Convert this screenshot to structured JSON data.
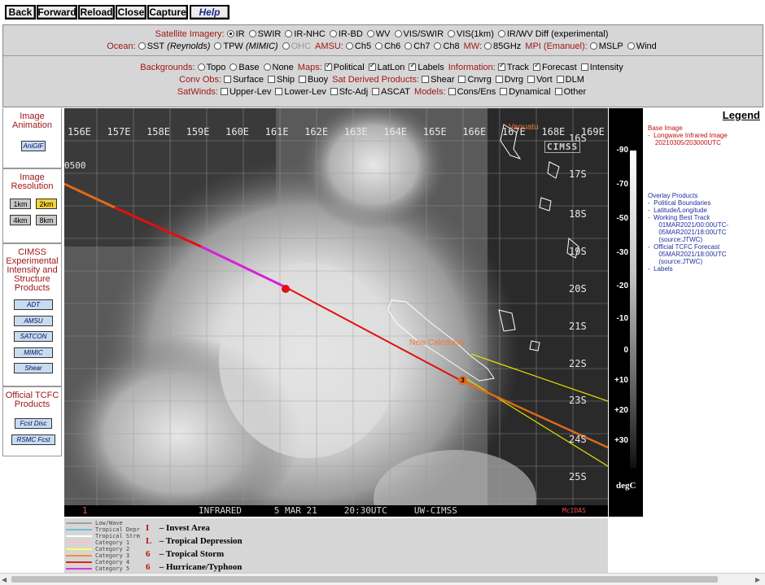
{
  "nav": {
    "back": "Back",
    "forward": "Forward",
    "reload": "Reload",
    "close": "Close",
    "capture": "Capture",
    "help": "Help"
  },
  "controls": {
    "satellite_label": "Satellite Imagery:",
    "sat_options": [
      "IR",
      "SWIR",
      "IR-NHC",
      "IR-BD",
      "WV",
      "VIS/SWIR",
      "VIS(1km)",
      "IR/WV Diff (experimental)"
    ],
    "ocean_label": "Ocean:",
    "sst": "SST",
    "sst_sub": "(Reynolds)",
    "tpw": "TPW",
    "tpw_sub": "(MIMIC)",
    "ohc": "OHC",
    "amsu_label": "AMSU:",
    "amsu_options": [
      "Ch5",
      "Ch6",
      "Ch7",
      "Ch8"
    ],
    "mw_label": "MW:",
    "mw_options": [
      "85GHz"
    ],
    "mpi_label": "MPI (Emanuel):",
    "mpi_options": [
      "MSLP",
      "Wind"
    ],
    "backgrounds_label": "Backgrounds:",
    "bg_options": [
      "Topo",
      "Base",
      "None"
    ],
    "maps_label": "Maps:",
    "maps_options": [
      "Political",
      "LatLon",
      "Labels"
    ],
    "info_label": "Information:",
    "info_options": [
      "Track",
      "Forecast",
      "Intensity"
    ],
    "conv_label": "Conv Obs:",
    "conv_options": [
      "Surface",
      "Ship",
      "Buoy"
    ],
    "satderived_label": "Sat Derived Products:",
    "satderived_options": [
      "Shear",
      "Cnvrg",
      "Dvrg",
      "Vort",
      "DLM"
    ],
    "satwinds_label": "SatWinds:",
    "satwinds_options": [
      "Upper-Lev",
      "Lower-Lev",
      "Sfc-Adj",
      "ASCAT"
    ],
    "models_label": "Models:",
    "models_options": [
      "Cons/Ens",
      "Dynamical",
      "Other"
    ]
  },
  "sidebar": {
    "animation_title": "Image Animation",
    "anigif": "AniGIF",
    "resolution_title": "Image Resolution",
    "res": [
      "1km",
      "2km",
      "4km",
      "8km"
    ],
    "cimss_title": "CIMSS Experimental Intensity and Structure Products",
    "cimss_buttons": [
      "ADT",
      "AMSU",
      "SATCON",
      "MIMIC",
      "Shear"
    ],
    "official_title": "Official TCFC Products",
    "official_buttons": [
      "Fcst Disc",
      "RSMC Fcst"
    ]
  },
  "map": {
    "lon_labels": [
      "156E",
      "157E",
      "158E",
      "159E",
      "160E",
      "161E",
      "162E",
      "163E",
      "164E",
      "165E",
      "166E",
      "167E",
      "168E",
      "169E"
    ],
    "lat_labels": [
      "16S",
      "17S",
      "18S",
      "19S",
      "20S",
      "21S",
      "22S",
      "23S",
      "24S",
      "25S"
    ],
    "time_label": "0500",
    "place_label": "New Caledonia",
    "top_place": "Vanuatu",
    "cimss_tag": "CIMSS",
    "footer_num": "1",
    "footer_text": "INFRARED      5 MAR 21     20:30UTC     UW-CIMSS",
    "mcidas": "McIDAS",
    "forecast_marker": "3",
    "colors": {
      "track_orange": "#e06a18",
      "track_red": "#e01010",
      "track_magenta": "#d820d8",
      "cone": "#e0e000"
    }
  },
  "colorbar": {
    "ticks": [
      "-90",
      "-70",
      "-50",
      "-30",
      "-20",
      "-10",
      "0",
      "+10",
      "+20",
      "+30"
    ],
    "unit": "degC"
  },
  "legend": {
    "title": "Legend",
    "base_header": "Base Image",
    "base_items": [
      "-  Longwave Infrared Image",
      "    20210305/203000UTC"
    ],
    "overlay_header": "Overlay Products",
    "overlay_items": [
      "-  Political Boundaries",
      "-  Latitude/Longitude",
      "-  Working Best Track",
      "      01MAR2021/00:00UTC-",
      "      05MAR2021/18:00UTC",
      "      (source:JTWC)",
      "-  Official TCFC Forecast",
      "      05MAR2021/18:00UTC",
      "      (source:JTWC)",
      "-  Labels"
    ]
  },
  "key": {
    "categories": [
      "Low/Wave",
      "Tropical Depr",
      "Tropical Strm",
      "Category 1",
      "Category 2",
      "Category 3",
      "Category 4",
      "Category 5"
    ],
    "category_colors": [
      "#a0a0a0",
      "#70c0d0",
      "#ffffff",
      "#ffc0c8",
      "#ffff60",
      "#f09030",
      "#e02020",
      "#e030e0"
    ],
    "symbols": [
      "– Invest Area",
      "– Tropical Depression",
      "– Tropical Storm",
      "– Hurricane/Typhoon"
    ],
    "symbol_glyphs": [
      "I",
      "L",
      "6",
      "6"
    ]
  }
}
